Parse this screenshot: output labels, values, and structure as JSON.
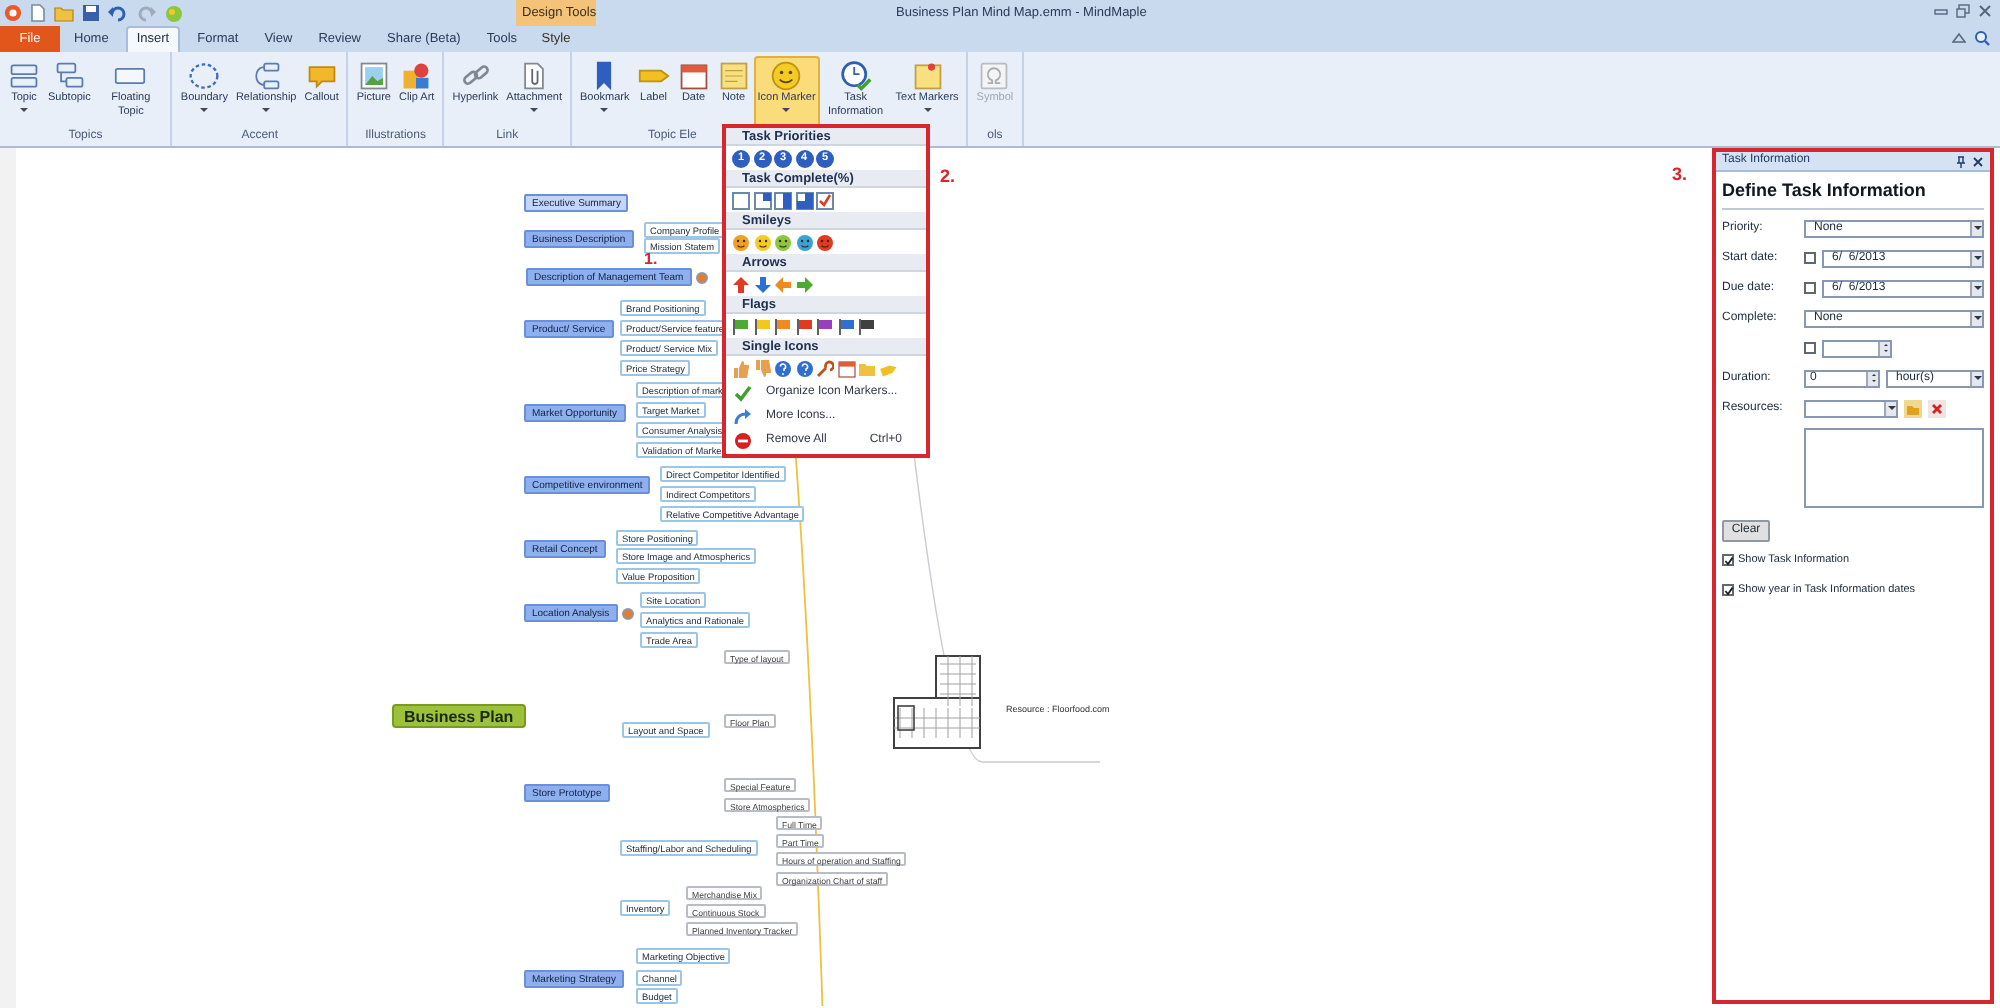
{
  "window": {
    "title": "Business Plan Mind Map.emm - MindMaple"
  },
  "ribbon_tabs": [
    {
      "label": "File",
      "kind": "file",
      "selected": false
    },
    {
      "label": "Home",
      "kind": "tab",
      "selected": false
    },
    {
      "label": "Insert",
      "kind": "tab",
      "selected": true
    },
    {
      "label": "Format",
      "kind": "tab",
      "selected": false
    },
    {
      "label": "View",
      "kind": "tab",
      "selected": false
    },
    {
      "label": "Review",
      "kind": "tab",
      "selected": false
    },
    {
      "label": "Share (Beta)",
      "kind": "tab",
      "selected": false
    },
    {
      "label": "Tools",
      "kind": "tab",
      "selected": false
    }
  ],
  "contextual_tabs": {
    "title": "Design Tools",
    "tabs": [
      {
        "label": "Style",
        "selected": false
      }
    ]
  },
  "ribbon_groups": [
    {
      "label": "Topics",
      "buttons": [
        {
          "label": "Topic",
          "kind": "topic",
          "dropdown": true,
          "selected": false,
          "disabled": false
        },
        {
          "label": "Subtopic",
          "kind": "subtopic",
          "dropdown": false,
          "selected": false,
          "disabled": false
        },
        {
          "label": "Floating Topic",
          "kind": "floating",
          "dropdown": false,
          "selected": false,
          "disabled": false
        }
      ]
    },
    {
      "label": "Accent",
      "buttons": [
        {
          "label": "Boundary",
          "kind": "boundary",
          "dropdown": true,
          "selected": false,
          "disabled": false
        },
        {
          "label": "Relationship",
          "kind": "relationship",
          "dropdown": true,
          "selected": false,
          "disabled": false
        },
        {
          "label": "Callout",
          "kind": "callout",
          "dropdown": false,
          "selected": false,
          "disabled": false
        }
      ]
    },
    {
      "label": "Illustrations",
      "buttons": [
        {
          "label": "Picture",
          "kind": "picture",
          "dropdown": false,
          "selected": false,
          "disabled": false
        },
        {
          "label": "Clip Art",
          "kind": "clipart",
          "dropdown": false,
          "selected": false,
          "disabled": false
        }
      ]
    },
    {
      "label": "Link",
      "buttons": [
        {
          "label": "Hyperlink",
          "kind": "hyperlink",
          "dropdown": false,
          "selected": false,
          "disabled": false
        },
        {
          "label": "Attachment",
          "kind": "attachment",
          "dropdown": true,
          "selected": false,
          "disabled": false
        }
      ]
    },
    {
      "label": "Topic Ele",
      "buttons": [
        {
          "label": "Bookmark",
          "kind": "bookmark",
          "dropdown": true,
          "selected": false,
          "disabled": false
        },
        {
          "label": "Label",
          "kind": "label",
          "dropdown": false,
          "selected": false,
          "disabled": false
        },
        {
          "label": "Date",
          "kind": "date",
          "dropdown": false,
          "selected": false,
          "disabled": false
        },
        {
          "label": "Note",
          "kind": "note",
          "dropdown": false,
          "selected": false,
          "disabled": false
        },
        {
          "label": "Icon Marker",
          "kind": "icon_marker",
          "dropdown": true,
          "selected": true,
          "disabled": false
        },
        {
          "label": "Task Information",
          "kind": "task",
          "dropdown": false,
          "selected": false,
          "disabled": false
        },
        {
          "label": "Text Markers",
          "kind": "text_markers",
          "dropdown": true,
          "selected": false,
          "disabled": false
        }
      ]
    },
    {
      "label": "ols",
      "buttons": [
        {
          "label": "Symbol",
          "kind": "symbol",
          "dropdown": false,
          "selected": false,
          "disabled": true
        }
      ]
    }
  ],
  "icon_marker_menu": {
    "sections": [
      {
        "title": "Task Priorities",
        "kind": "priority",
        "icons": [
          {
            "text": "1"
          },
          {
            "text": "2"
          },
          {
            "text": "3"
          },
          {
            "text": "4"
          },
          {
            "text": "5"
          }
        ]
      },
      {
        "title": "Task Complete(%)",
        "kind": "complete",
        "icons": [
          {
            "kind": "empty"
          },
          {
            "kind": "quarter"
          },
          {
            "kind": "half"
          },
          {
            "kind": "three_quarters"
          },
          {
            "kind": "done"
          }
        ]
      },
      {
        "title": "Smileys",
        "kind": "smiley",
        "icons": [
          {
            "color": "#f0a020"
          },
          {
            "color": "#f2cc20"
          },
          {
            "color": "#8cc63e"
          },
          {
            "color": "#3aa0d8"
          },
          {
            "color": "#e03a20"
          }
        ]
      },
      {
        "title": "Arrows",
        "kind": "arrow",
        "icons": [
          {
            "kind": "up",
            "color": "#e03a20"
          },
          {
            "kind": "down",
            "color": "#2e6fd0"
          },
          {
            "kind": "left",
            "color": "#f08a20"
          },
          {
            "kind": "right",
            "color": "#4caa30"
          }
        ]
      },
      {
        "title": "Flags",
        "kind": "flag",
        "icons": [
          {
            "color": "#4caa30"
          },
          {
            "color": "#f2c820"
          },
          {
            "color": "#f08a20"
          },
          {
            "color": "#e03a20"
          },
          {
            "color": "#9a3ec0"
          },
          {
            "color": "#2e6fd0"
          },
          {
            "color": "#404040"
          }
        ]
      },
      {
        "title": "Single Icons",
        "kind": "single",
        "icons": [
          {
            "kind": "thumbs_up"
          },
          {
            "kind": "thumbs_down"
          },
          {
            "kind": "question"
          },
          {
            "kind": "question"
          },
          {
            "kind": "wrench"
          },
          {
            "kind": "calendar"
          },
          {
            "kind": "folder"
          },
          {
            "kind": "tag"
          }
        ]
      }
    ],
    "commands": [
      {
        "label": "Organize Icon Markers...",
        "kind": "organize"
      },
      {
        "label": "More Icons...",
        "kind": "more"
      },
      {
        "label": "Remove All",
        "kind": "remove",
        "shortcut": "Ctrl+0"
      }
    ]
  },
  "mind_map": {
    "root": "Business Plan",
    "topics": [
      {
        "text": "Executive Summary",
        "selected": true,
        "marker": false
      },
      {
        "text": "Business Description",
        "selected": false,
        "marker": false,
        "children": [
          {
            "text": "Company Profile"
          },
          {
            "text": "Mission Statem"
          }
        ]
      },
      {
        "text": "Description of Management Team",
        "selected": false,
        "marker": true
      },
      {
        "text": "Product/ Service",
        "selected": false,
        "marker": false,
        "children": [
          {
            "text": "Brand Positioning"
          },
          {
            "text": "Product/Service feature"
          },
          {
            "text": "Product/ Service Mix"
          },
          {
            "text": "Price Strategy"
          }
        ]
      },
      {
        "text": "Market Opportunity",
        "selected": false,
        "marker": false,
        "children": [
          {
            "text": "Description of mark"
          },
          {
            "text": "Target Market"
          },
          {
            "text": "Consumer Analysis"
          },
          {
            "text": "Validation of Marke"
          }
        ]
      },
      {
        "text": "Competitive environment",
        "selected": false,
        "marker": false,
        "children": [
          {
            "text": "Direct Competitor Identified"
          },
          {
            "text": "Indirect Competitors"
          },
          {
            "text": "Relative Competitive Advantage"
          }
        ]
      },
      {
        "text": "Retail Concept",
        "selected": false,
        "marker": false,
        "children": [
          {
            "text": "Store Positioning"
          },
          {
            "text": "Store Image and Atmospherics"
          },
          {
            "text": "Value Proposition"
          }
        ]
      },
      {
        "text": "Location Analysis",
        "selected": false,
        "marker": true,
        "children": [
          {
            "text": "Site Location"
          },
          {
            "text": "Analytics and Rationale"
          },
          {
            "text": "Trade Area"
          }
        ]
      },
      {
        "text": "Store Prototype",
        "selected": false,
        "marker": false,
        "children": [
          {
            "text": "Layout and Space",
            "children": [
              {
                "text": "Type of layout"
              },
              {
                "text": "Floor Plan"
              },
              {
                "text": "Special Feature"
              },
              {
                "text": "Store Atmospherics"
              }
            ]
          },
          {
            "text": "Staffing/Labor and Scheduling",
            "children": [
              {
                "text": "Full Time"
              },
              {
                "text": "Part Time"
              },
              {
                "text": "Hours of operation and Staffing"
              },
              {
                "text": "Organization Chart of staff"
              }
            ]
          },
          {
            "text": "Inventory",
            "children": [
              {
                "text": "Merchandise Mix"
              },
              {
                "text": "Continuous Stock"
              },
              {
                "text": "Planned Inventory Tracker"
              }
            ]
          }
        ]
      },
      {
        "text": "Marketing Strategy",
        "selected": false,
        "marker": false,
        "children": [
          {
            "text": "Marketing Objective"
          },
          {
            "text": "Channel"
          },
          {
            "text": "Budget"
          }
        ]
      }
    ],
    "image_caption": "Resource : Floorfood.com"
  },
  "annotations": [
    "1.",
    "2.",
    "3."
  ],
  "task_panel": {
    "title": "Task Information",
    "heading": "Define Task Information",
    "fields": [
      {
        "kind": "select",
        "label": "Priority:",
        "value": "None"
      },
      {
        "kind": "date",
        "label": "Start date:",
        "checked": false,
        "value": "6/  6/2013"
      },
      {
        "kind": "date",
        "label": "Due date:",
        "checked": false,
        "value": "6/  6/2013"
      },
      {
        "kind": "select",
        "label": "Complete:",
        "value": "None"
      },
      {
        "kind": "check_spin",
        "checked": false
      },
      {
        "kind": "duration",
        "label": "Duration:",
        "value": "0",
        "unit": "hour(s)"
      },
      {
        "kind": "resources",
        "label": "Resources:"
      }
    ],
    "clear_button": "Clear",
    "options": [
      {
        "label": "Show Task Information",
        "checked": true
      },
      {
        "label": "Show year in Task Information dates",
        "checked": true
      }
    ]
  }
}
